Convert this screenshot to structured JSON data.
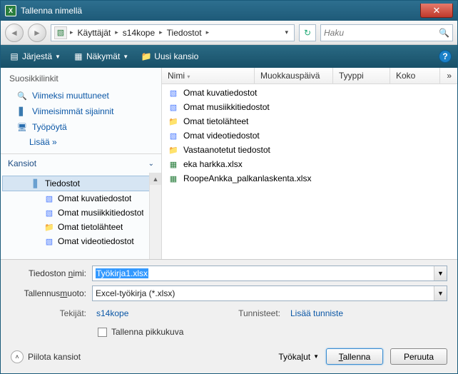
{
  "window": {
    "title": "Tallenna nimellä"
  },
  "breadcrumb": {
    "segments": [
      "Käyttäjät",
      "s14kope",
      "Tiedostot"
    ]
  },
  "search": {
    "placeholder": "Haku"
  },
  "toolbar": {
    "organize": "Järjestä",
    "views": "Näkymät",
    "newfolder": "Uusi kansio"
  },
  "sidebar": {
    "fav_header": "Suosikkilinkit",
    "favorites": [
      {
        "label": "Viimeksi muuttuneet"
      },
      {
        "label": "Viimeisimmät sijainnit"
      },
      {
        "label": "Työpöytä"
      }
    ],
    "more": "Lisää »",
    "folders_header": "Kansiot",
    "tree": [
      {
        "label": "Tiedostot",
        "selected": true
      },
      {
        "label": "Omat kuvatiedostot"
      },
      {
        "label": "Omat musiikkitiedostot"
      },
      {
        "label": "Omat tietolähteet"
      },
      {
        "label": "Omat videotiedostot"
      }
    ]
  },
  "columns": {
    "name": "Nimi",
    "modified": "Muokkauspäivä",
    "type": "Tyyppi",
    "size": "Koko",
    "more": "»"
  },
  "files": [
    {
      "icon": "short",
      "label": "Omat kuvatiedostot"
    },
    {
      "icon": "short",
      "label": "Omat musiikkitiedostot"
    },
    {
      "icon": "folder",
      "label": "Omat tietolähteet"
    },
    {
      "icon": "short",
      "label": "Omat videotiedostot"
    },
    {
      "icon": "folder",
      "label": "Vastaanotetut tiedostot"
    },
    {
      "icon": "xl",
      "label": "eka harkka.xlsx"
    },
    {
      "icon": "xl",
      "label": "RoopeAnkka_palkanlaskenta.xlsx"
    }
  ],
  "form": {
    "filename_label": "Tiedoston nimi:",
    "filename_value": "Työkirja1.xlsx",
    "type_label": "Tallennusmuoto:",
    "type_value": "Excel-työkirja (*.xlsx)",
    "authors_label": "Tekijät:",
    "authors_value": "s14kope",
    "tags_label": "Tunnisteet:",
    "tags_value": "Lisää tunniste",
    "thumbnail": "Tallenna pikkukuva"
  },
  "footer": {
    "hide_folders": "Piilota kansiot",
    "tools": "Työkalut",
    "save": "Tallenna",
    "cancel": "Peruuta"
  }
}
